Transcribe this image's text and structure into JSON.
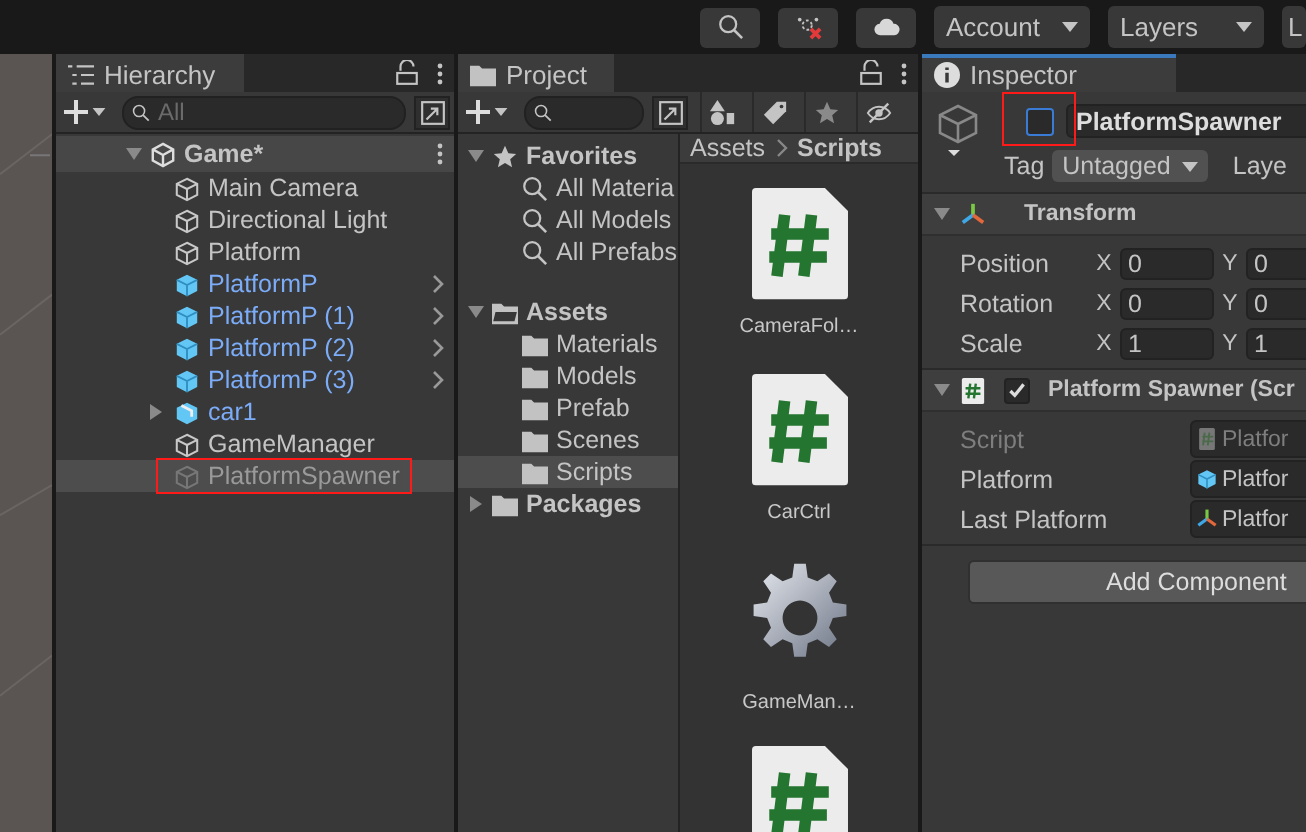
{
  "toolbar": {
    "dropdowns": [
      "Account",
      "Layers",
      "L"
    ]
  },
  "hierarchy": {
    "title": "Hierarchy",
    "search": {
      "placeholder": "All"
    },
    "scene": {
      "name": "Game*",
      "expanded": true,
      "children": [
        {
          "name": "Main Camera",
          "kind": "object",
          "active": true,
          "selected": false,
          "highlighted": false
        },
        {
          "name": "Directional Light",
          "kind": "object",
          "active": true,
          "selected": false,
          "highlighted": false
        },
        {
          "name": "Platform",
          "kind": "object",
          "active": true,
          "selected": false,
          "highlighted": false
        },
        {
          "name": "PlatformP",
          "kind": "prefab",
          "active": true,
          "selected": false,
          "highlighted": false
        },
        {
          "name": "PlatformP (1)",
          "kind": "prefab",
          "active": true,
          "selected": false,
          "highlighted": false
        },
        {
          "name": "PlatformP (2)",
          "kind": "prefab",
          "active": true,
          "selected": false,
          "highlighted": false
        },
        {
          "name": "PlatformP (3)",
          "kind": "prefab",
          "active": true,
          "selected": false,
          "highlighted": false
        },
        {
          "name": "car1",
          "kind": "model",
          "expanded": false,
          "active": true,
          "selected": false,
          "highlighted": false
        },
        {
          "name": "GameManager",
          "kind": "object",
          "active": true,
          "selected": false,
          "highlighted": false
        },
        {
          "name": "PlatformSpawner",
          "kind": "object",
          "active": false,
          "selected": true,
          "highlighted": true
        }
      ]
    }
  },
  "project": {
    "title": "Project",
    "favorites": {
      "name": "Favorites",
      "expanded": true,
      "items": [
        "All Materia",
        "All Models",
        "All Prefabs"
      ]
    },
    "assets": {
      "name": "Assets",
      "expanded": true,
      "children": [
        {
          "name": "Materials",
          "selected": false
        },
        {
          "name": "Models",
          "selected": false
        },
        {
          "name": "Prefab",
          "selected": false
        },
        {
          "name": "Scenes",
          "selected": false
        },
        {
          "name": "Scripts",
          "selected": true
        }
      ]
    },
    "packages": {
      "name": "Packages",
      "expanded": false
    },
    "breadcrumb": [
      "Assets",
      "Scripts"
    ],
    "files": [
      {
        "name": "CameraFol…",
        "kind": "script"
      },
      {
        "name": "CarCtrl",
        "kind": "script"
      },
      {
        "name": "GameMan…",
        "kind": "gear"
      },
      {
        "kind": "script"
      }
    ]
  },
  "inspector": {
    "title": "Inspector",
    "object_name": "PlatformSpawner",
    "active": false,
    "highlighted": true,
    "tag_label": "Tag",
    "tag": "Untagged",
    "layer_label": "Laye",
    "transform": {
      "title": "Transform",
      "expanded": true,
      "rows": [
        {
          "label": "Position",
          "fields": [
            {
              "axis": "X",
              "value": "0"
            },
            {
              "axis": "Y",
              "value": "0"
            }
          ]
        },
        {
          "label": "Rotation",
          "fields": [
            {
              "axis": "X",
              "value": "0"
            },
            {
              "axis": "Y",
              "value": "0"
            }
          ]
        },
        {
          "label": "Scale",
          "fields": [
            {
              "axis": "X",
              "value": "1"
            },
            {
              "axis": "Y",
              "value": "1"
            }
          ]
        }
      ]
    },
    "script_component": {
      "title": "Platform Spawner (Scr",
      "expanded": true,
      "enabled": true,
      "fields": [
        {
          "label": "Script",
          "value": "Platfor",
          "kind": "script",
          "disabled": true
        },
        {
          "label": "Platform",
          "value": "Platfor",
          "kind": "prefab",
          "disabled": false
        },
        {
          "label": "Last Platform",
          "value": "Platfor",
          "kind": "transform",
          "disabled": false
        }
      ]
    },
    "add_button": "Add Component"
  }
}
